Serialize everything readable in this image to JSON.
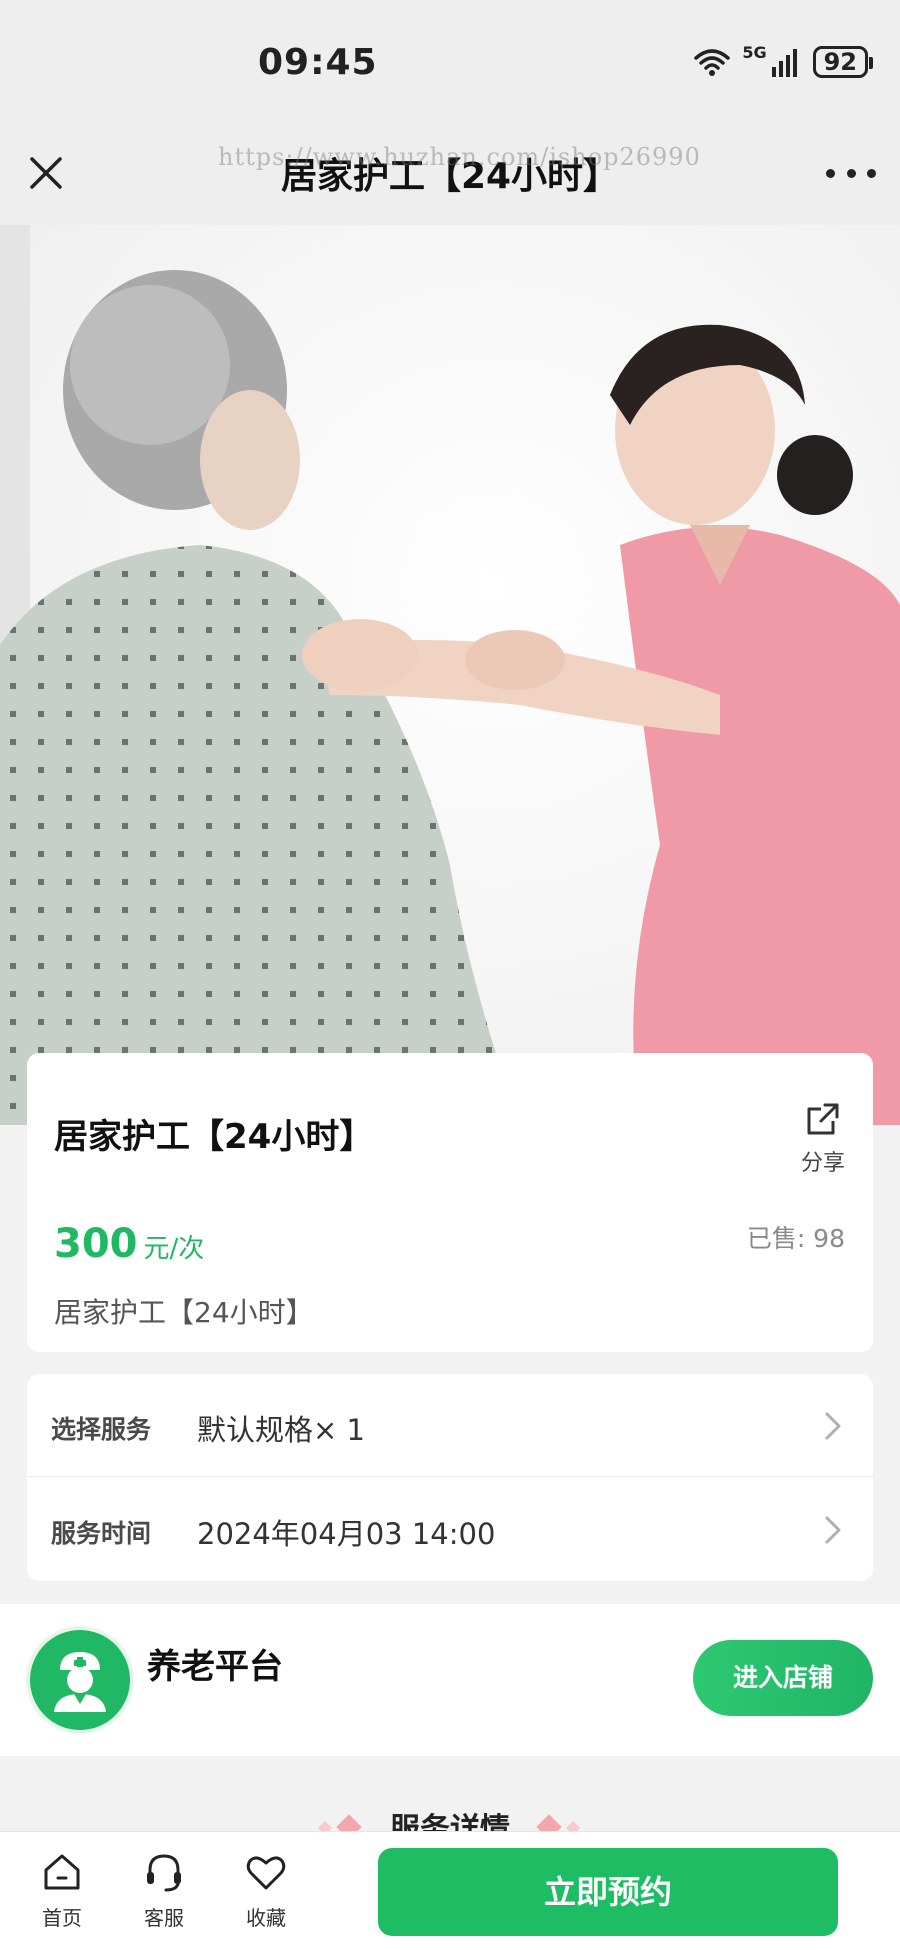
{
  "status_bar": {
    "time": "09:45",
    "network": "5G",
    "battery": "92"
  },
  "nav": {
    "title": "居家护工【24小时】",
    "watermark": "https://www.huzhan.com/ishop26990"
  },
  "product": {
    "title": "居家护工【24小时】",
    "share_label": "分享",
    "price": "300",
    "price_unit": "元/次",
    "sold_label": "已售: 98",
    "description": "居家护工【24小时】"
  },
  "options": [
    {
      "label": "选择服务",
      "value": "默认规格× 1"
    },
    {
      "label": "服务时间",
      "value": "2024年04月03 14:00"
    }
  ],
  "store": {
    "name": "养老平台",
    "enter_label": "进入店铺"
  },
  "detail": {
    "title": "服务详情"
  },
  "bottom_bar": {
    "tabs": [
      {
        "label": "首页",
        "icon": "home-icon"
      },
      {
        "label": "客服",
        "icon": "headset-icon"
      },
      {
        "label": "收藏",
        "icon": "heart-icon"
      }
    ],
    "book_label": "立即预约"
  },
  "colors": {
    "accent": "#1fbd63",
    "price": "#1fb863"
  }
}
